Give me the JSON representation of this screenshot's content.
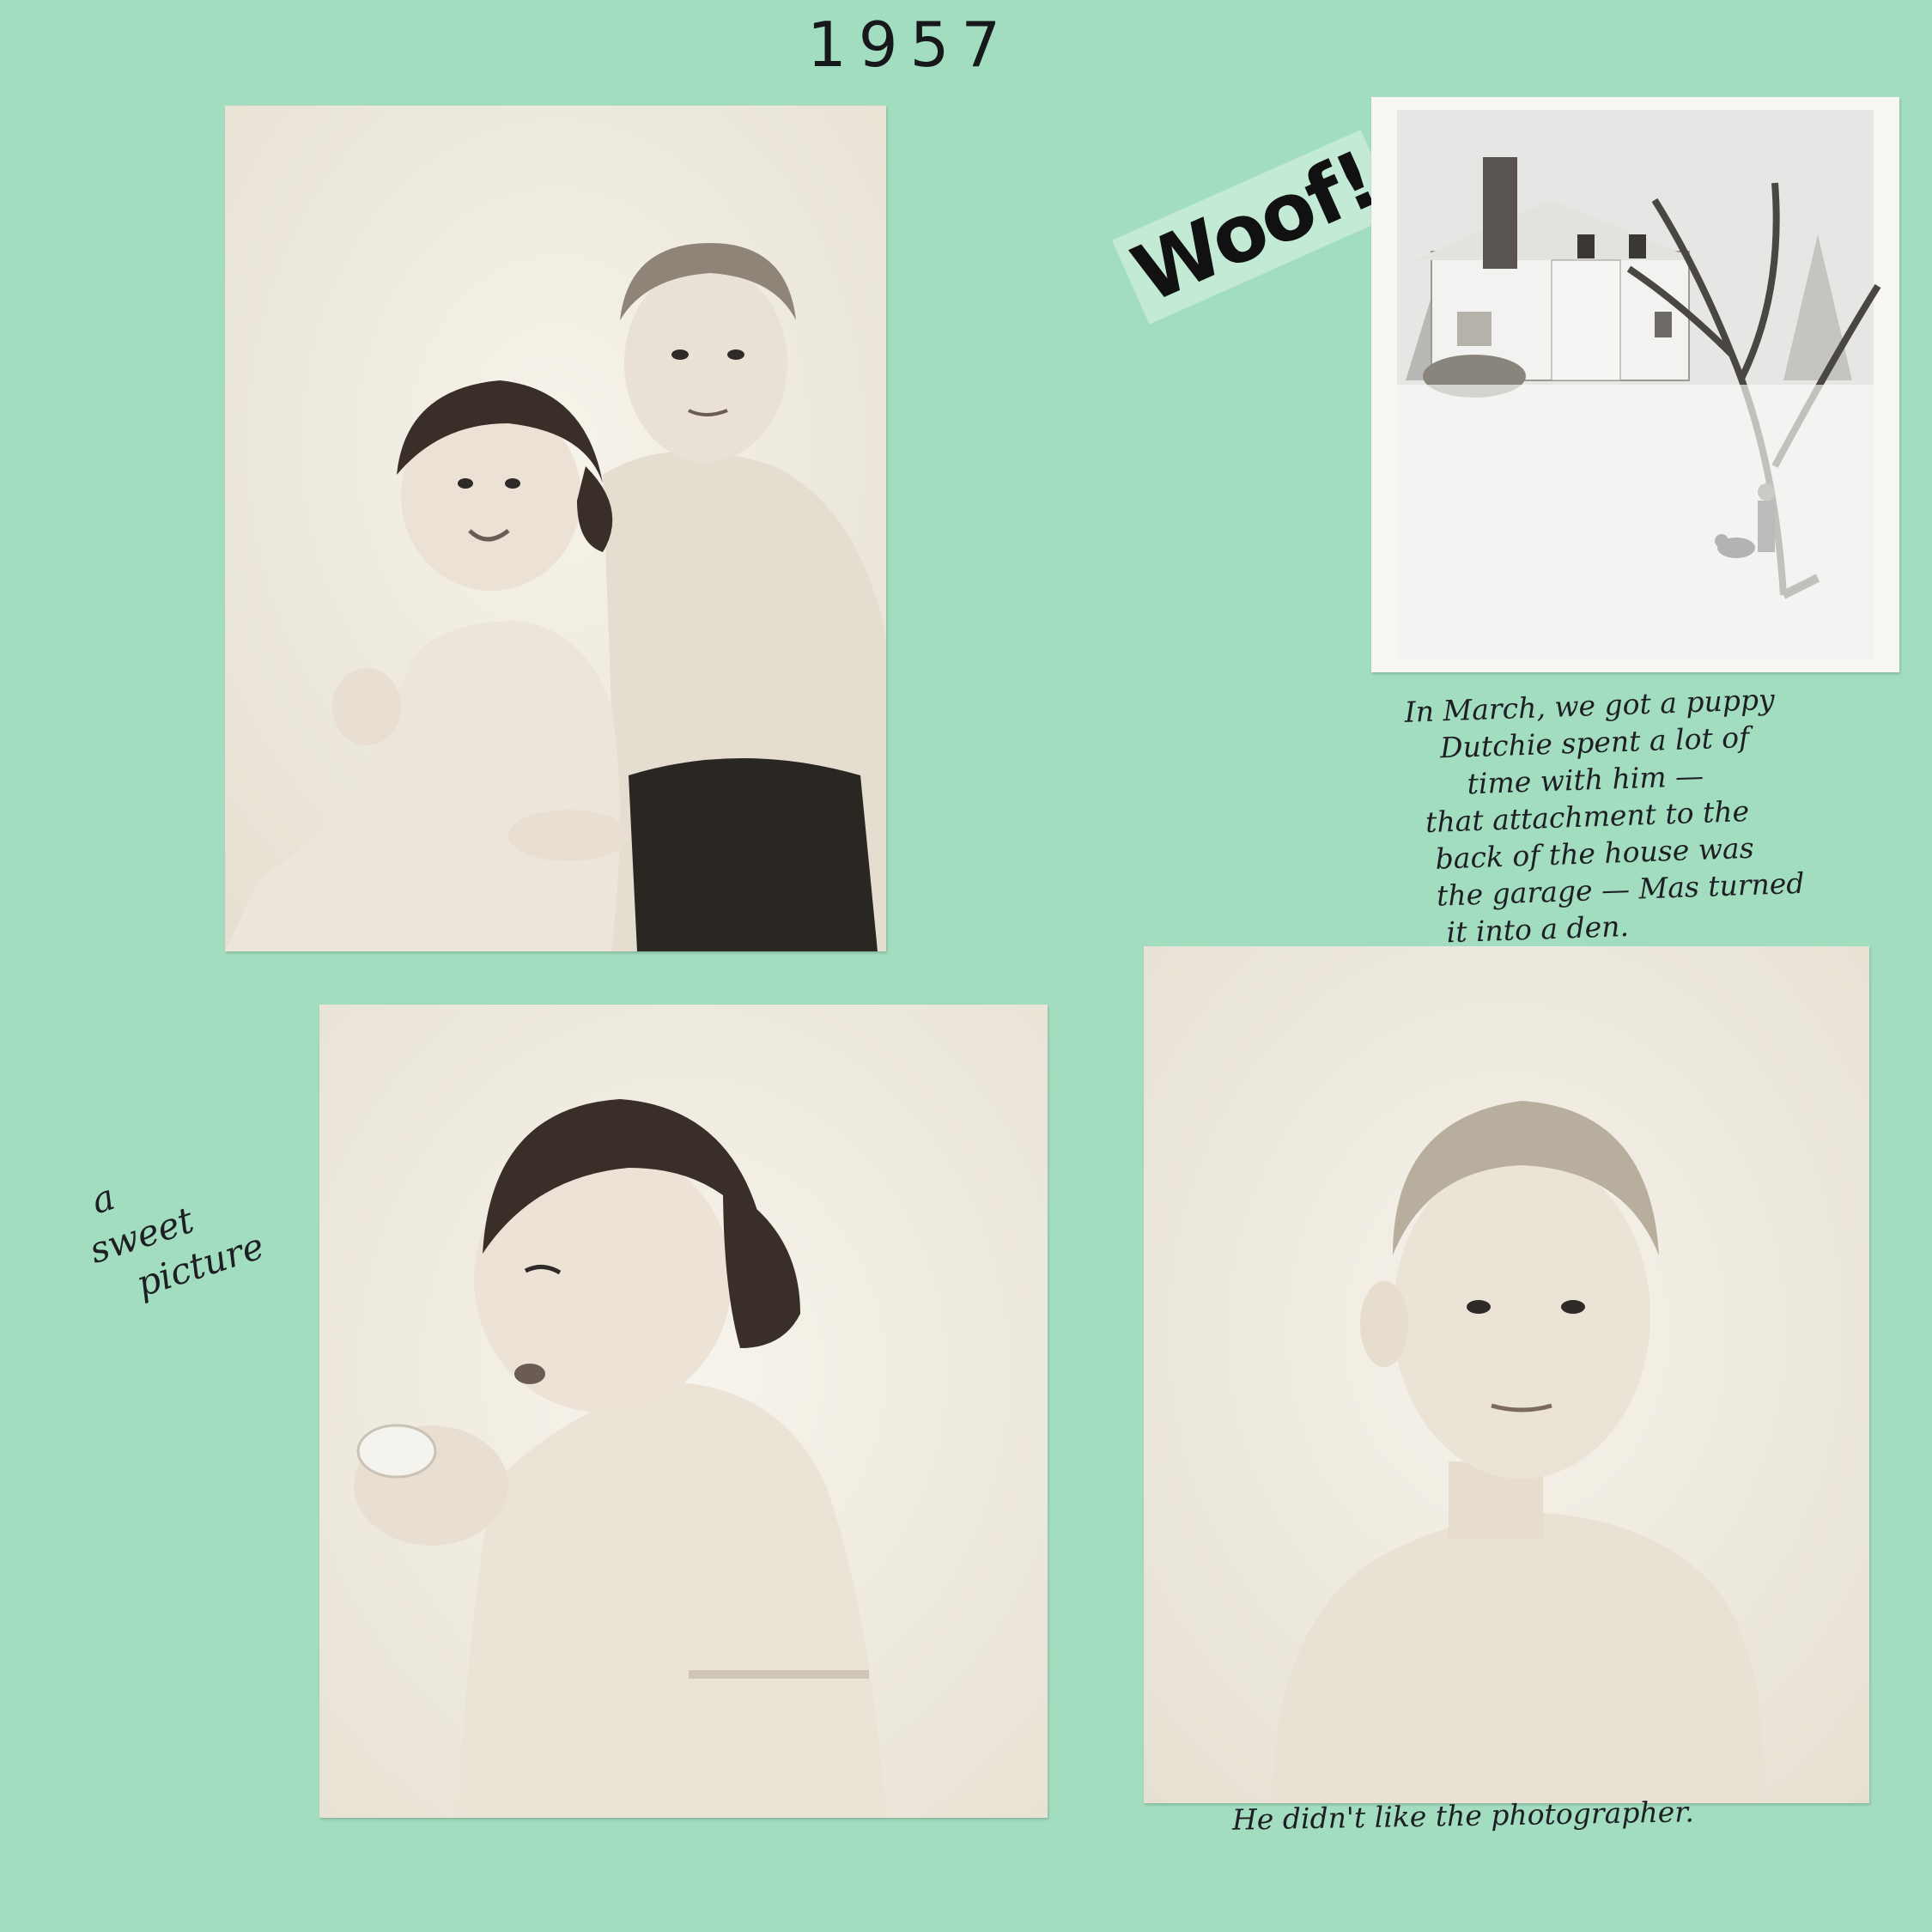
{
  "page": {
    "year": "1957",
    "sticker": "Woof!",
    "background_color": "#a3ddbf"
  },
  "photos": [
    {
      "name": "photo-siblings",
      "subject": "toddler girl and young boy seated together, studio portrait"
    },
    {
      "name": "photo-snow-house",
      "subject": "white house in snow with bare tree, child and puppy"
    },
    {
      "name": "photo-girl",
      "subject": "toddler girl holding a glass"
    },
    {
      "name": "photo-boy",
      "subject": "young boy in t-shirt, studio portrait"
    }
  ],
  "captions": {
    "march": [
      "In March, we got a puppy",
      "Dutchie spent a lot of",
      "time with him —",
      "that attachment to the",
      "back of the house was",
      "the garage — Mas turned",
      "it into a den."
    ],
    "sweet": [
      "a",
      "sweet",
      "picture"
    ],
    "photographer": "He didn't like the photographer."
  }
}
